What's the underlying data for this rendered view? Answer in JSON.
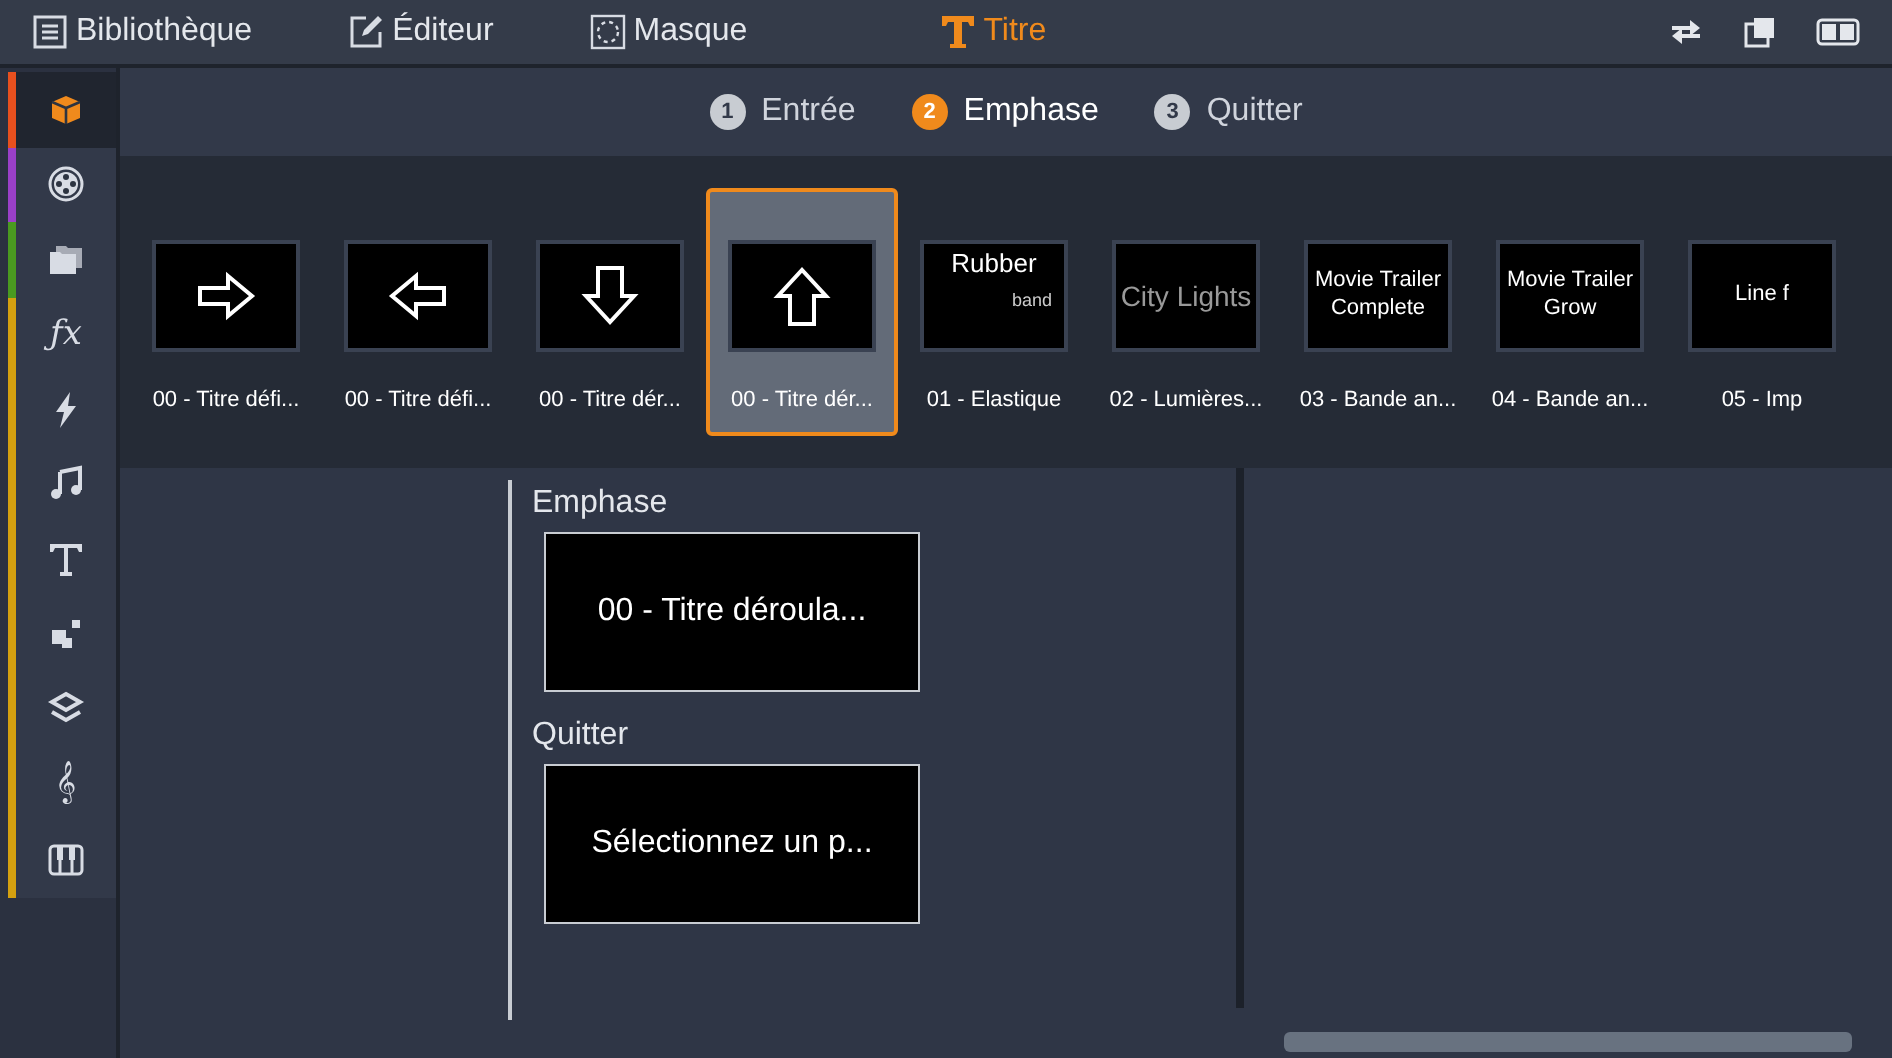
{
  "top_tabs": [
    {
      "label": "Bibliothèque",
      "selected": false
    },
    {
      "label": "Éditeur",
      "selected": false
    },
    {
      "label": "Masque",
      "selected": false
    },
    {
      "label": "Titre",
      "selected": true
    }
  ],
  "sidebar": {
    "items": [
      {
        "color": "#e8501e",
        "selected": true
      },
      {
        "color": "#9b40c8",
        "selected": false
      },
      {
        "color": "#4a9a20",
        "selected": false
      },
      {
        "symbol": "ƒx",
        "color": "#d4a010",
        "selected": false
      },
      {
        "color": "#d4a010",
        "selected": false
      },
      {
        "color": "#d4a010",
        "selected": false
      },
      {
        "color": "#d4a010",
        "selected": false
      },
      {
        "color": "#d4a010",
        "selected": false
      },
      {
        "color": "#d4a010",
        "selected": false
      },
      {
        "symbol": "𝄞",
        "color": "#d4a010",
        "selected": false
      },
      {
        "color": "#d4a010",
        "selected": false
      }
    ]
  },
  "steps": [
    {
      "number": "1",
      "label": "Entrée",
      "selected": false
    },
    {
      "number": "2",
      "label": "Emphase",
      "selected": true
    },
    {
      "number": "3",
      "label": "Quitter",
      "selected": false
    }
  ],
  "presets": [
    {
      "kind": "right",
      "label": "00 - Titre défi...",
      "selected": false
    },
    {
      "kind": "left",
      "label": "00 - Titre défi...",
      "selected": false
    },
    {
      "kind": "down",
      "label": "00 - Titre dér...",
      "selected": false
    },
    {
      "kind": "up",
      "label": "00 - Titre dér...",
      "selected": true
    },
    {
      "kind": "rubber",
      "preview": [
        "Rubber",
        "band"
      ],
      "label": "01 - Elastique",
      "selected": false
    },
    {
      "kind": "lights",
      "preview": [
        "City Lights"
      ],
      "label": "02 - Lumières...",
      "selected": false
    },
    {
      "kind": "centered",
      "preview": [
        "Movie Trailer",
        "Complete"
      ],
      "label": "03 - Bande an...",
      "selected": false
    },
    {
      "kind": "centered",
      "preview": [
        "Movie Trailer",
        "Grow"
      ],
      "label": "04 - Bande an...",
      "selected": false
    },
    {
      "kind": "centered",
      "preview": [
        "Line f"
      ],
      "label": "05 - Imp",
      "selected": false
    }
  ],
  "slots": [
    {
      "heading": "Emphase",
      "value": "00 - Titre déroula..."
    },
    {
      "heading": "Quitter",
      "value": "Sélectionnez un p..."
    }
  ]
}
